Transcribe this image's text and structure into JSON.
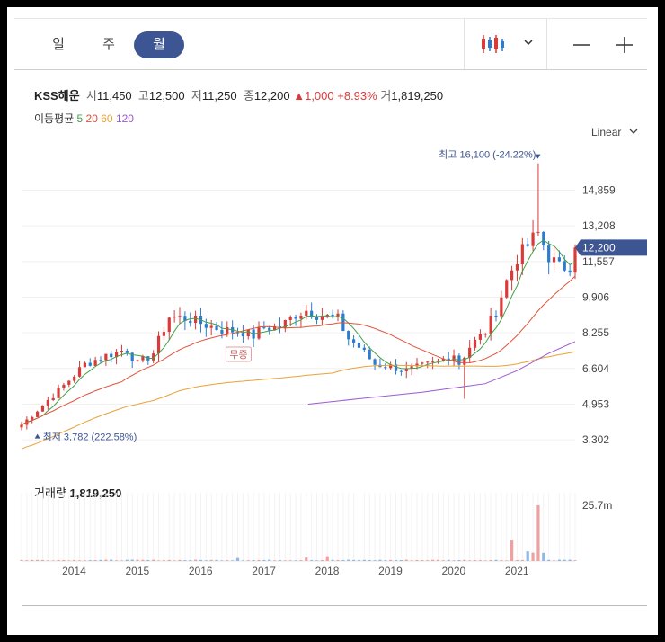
{
  "tabs": [
    {
      "label": "일",
      "active": false
    },
    {
      "label": "주",
      "active": false
    },
    {
      "label": "월",
      "active": true
    }
  ],
  "toolbar": {
    "chart_type_icon": "candlestick-icon",
    "dropdown_icon": "chevron-down-icon",
    "zoom_out_icon": "minus-icon",
    "zoom_in_icon": "plus-icon"
  },
  "stock": {
    "name": "KSS해운",
    "open_label": "시",
    "open": "11,450",
    "high_label": "고",
    "high": "12,500",
    "low_label": "저",
    "low": "11,250",
    "close_label": "종",
    "close": "12,200",
    "change": "▲1,000",
    "change_pct": "+8.93%",
    "volume_label": "거",
    "volume": "1,819,250"
  },
  "moving_average": {
    "label": "이동평균",
    "periods": [
      {
        "label": "5",
        "color": "#43a047"
      },
      {
        "label": "20",
        "color": "#e0523a"
      },
      {
        "label": "60",
        "color": "#e8a23a"
      },
      {
        "label": "120",
        "color": "#9b59d0"
      }
    ]
  },
  "scale": {
    "label": "Linear",
    "icon": "chevron-down-icon"
  },
  "colors": {
    "up": "#d93a3a",
    "down": "#2b7bd1",
    "accent": "#3d5592"
  },
  "chart_data": {
    "type": "candlestick",
    "y_ticks": [
      "14,859",
      "13,208",
      "11,557",
      "9,906",
      "8,255",
      "6,604",
      "4,953",
      "3,302"
    ],
    "y_tick_values": [
      14859,
      13208,
      11557,
      9906,
      8255,
      6604,
      4953,
      3302
    ],
    "ylim": [
      2600,
      17000
    ],
    "x_ticks": [
      "2014",
      "2015",
      "2016",
      "2017",
      "2018",
      "2019",
      "2020",
      "2021"
    ],
    "x_start": 2013.17,
    "x_end": 2021.92,
    "last_price_label": "12,200",
    "last_price": 12200,
    "max_label": "최고 16,100 (-24.22%)",
    "max_value": 16100,
    "max_x": 2021.33,
    "min_label": "최저 3,782 (222.58%)",
    "min_value": 3782,
    "min_x": 2013.25,
    "event_label": "무증",
    "event_x": 2016.6,
    "close_anchors": [
      [
        2013.17,
        4000
      ],
      [
        2013.5,
        4900
      ],
      [
        2013.83,
        5800
      ],
      [
        2014.17,
        6800
      ],
      [
        2014.5,
        7200
      ],
      [
        2014.83,
        7500
      ],
      [
        2015.0,
        6800
      ],
      [
        2015.25,
        7300
      ],
      [
        2015.5,
        9000
      ],
      [
        2015.83,
        8900
      ],
      [
        2016.0,
        8700
      ],
      [
        2016.33,
        8400
      ],
      [
        2016.67,
        8300
      ],
      [
        2016.83,
        8100
      ],
      [
        2017.0,
        8500
      ],
      [
        2017.25,
        8500
      ],
      [
        2017.5,
        9100
      ],
      [
        2017.67,
        9300
      ],
      [
        2017.83,
        9100
      ],
      [
        2018.0,
        9000
      ],
      [
        2018.17,
        8900
      ],
      [
        2018.33,
        8000
      ],
      [
        2018.5,
        7600
      ],
      [
        2018.75,
        6800
      ],
      [
        2019.0,
        6700
      ],
      [
        2019.25,
        6500
      ],
      [
        2019.5,
        6700
      ],
      [
        2019.75,
        6900
      ],
      [
        2020.0,
        7300
      ],
      [
        2020.08,
        6800
      ],
      [
        2020.25,
        7600
      ],
      [
        2020.5,
        8300
      ],
      [
        2020.67,
        9300
      ],
      [
        2020.83,
        10600
      ],
      [
        2021.0,
        11700
      ],
      [
        2021.17,
        12300
      ],
      [
        2021.33,
        12900
      ],
      [
        2021.5,
        11800
      ],
      [
        2021.67,
        11300
      ],
      [
        2021.83,
        11300
      ],
      [
        2021.92,
        12200
      ]
    ],
    "ma5_range": [
      2013.17,
      2021.92
    ],
    "ma20_range": [
      2013.17,
      2021.92
    ],
    "ma60_range": [
      2013.17,
      2021.92
    ],
    "ma120_anchors": [
      [
        2017.7,
        4950
      ],
      [
        2018.5,
        5200
      ],
      [
        2019.5,
        5500
      ],
      [
        2020.5,
        5900
      ],
      [
        2021.0,
        6500
      ],
      [
        2021.5,
        7300
      ],
      [
        2021.92,
        7850
      ]
    ],
    "volume": {
      "label": "거래량",
      "value": "1,819,250",
      "y_tick": "25.7m",
      "y_tick_value": 25700000,
      "notable": [
        [
          2016.6,
          1400000
        ],
        [
          2017.7,
          1600000
        ],
        [
          2018.0,
          2200000
        ],
        [
          2020.92,
          9500000
        ],
        [
          2021.17,
          4500000
        ],
        [
          2021.25,
          3900000
        ],
        [
          2021.33,
          25700000
        ],
        [
          2021.42,
          3800000
        ]
      ]
    }
  }
}
